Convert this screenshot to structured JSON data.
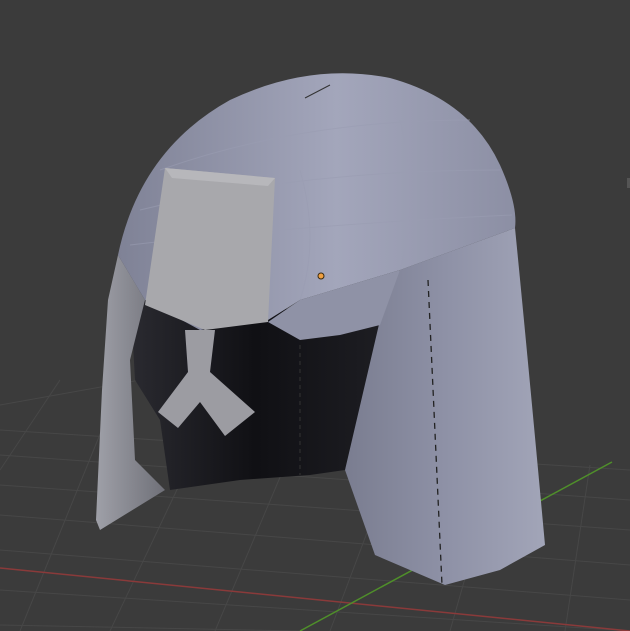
{
  "viewport": {
    "background_color": "#3b3b3b",
    "grid_color": "#4a4a4a",
    "x_axis_color": "#8a3a3a",
    "y_axis_color": "#4f8f2a"
  },
  "scene": {
    "object_icon": "helmet-mesh",
    "origin_marker_icon": "object-origin-dot",
    "origin_color": "#f0a040",
    "mesh_color": "#8e92a8",
    "shading": "solid"
  }
}
